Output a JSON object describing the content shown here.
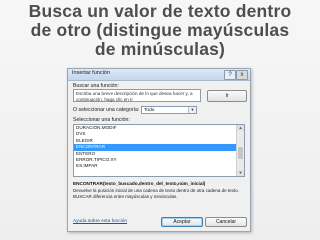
{
  "slide": {
    "title": "Busca un valor de texto dentro de otro (distingue mayúsculas de minúsculas)"
  },
  "dialog": {
    "title": "Insertar función",
    "help_glyph": "?",
    "close_glyph": "x",
    "search_label": "Buscar una función:",
    "search_value": "Escriba una breve descripción de lo que desea hacer y, a continuación, haga clic en Ir",
    "go_button": "Ir",
    "category_label": "O seleccionar una categoría:",
    "category_value": "Todo",
    "list_label": "Seleccionar una función:",
    "functions": [
      "DURACION.MODIF",
      "DVS",
      "ELEGIR",
      "ENCONTRAR",
      "ENTERO",
      "ERROR.TIPICO.XY",
      "ES.IMPAR"
    ],
    "selected_function": "ENCONTRAR",
    "syntax": "ENCONTRAR(texto_buscado,dentro_del_texto,núm_inicial)",
    "description": "Devuelve la posición inicial de una cadena de texto dentro de otra cadena de texto. BUSCAR diferencia entre mayúsculas y minúsculas.",
    "help_link": "Ayuda sobre esta función",
    "ok_button": "Aceptar",
    "cancel_button": "Cancelar"
  }
}
